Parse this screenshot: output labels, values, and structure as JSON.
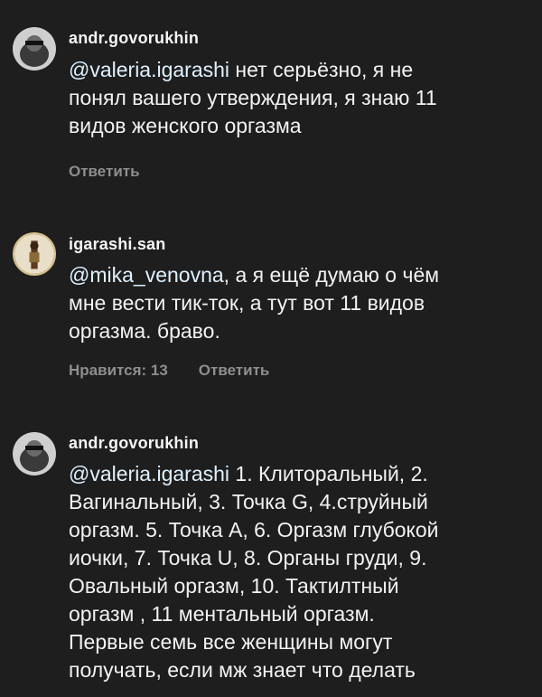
{
  "comments": [
    {
      "username": "andr.govorukhin",
      "mention": "@valeria.igarashi",
      "text_line1": " нет серьёзно,  я не",
      "text_line2": "понял вашего утверждения, я знаю 11",
      "text_line3": "видов женского оргазма",
      "reply": "Ответить"
    },
    {
      "username": "igarashi.san",
      "mention": "@mika_venovna",
      "text_line1": ", а я ещё думаю о чём",
      "text_line2": "мне вести тик-ток, а тут вот 11 видов",
      "text_line3": "оргазма. браво.",
      "likes": "Нравится: 13",
      "reply": "Ответить"
    },
    {
      "username": "andr.govorukhin",
      "mention": "@valeria.igarashi",
      "text_line1": " 1. Клиторальный, 2.",
      "text_line2": "Вагинальный, 3. Точка G, 4.струйный",
      "text_line3": "оргазм. 5. Точка А, 6. Оргазм глубокой",
      "text_line4": "иочки, 7. Точка U, 8. Органы груди, 9.",
      "text_line5": "Овальный оргазм, 10. Тактилтный",
      "text_line6": "оргазм , 11 ментальный оргазм.",
      "text_line7": "Первые семь все женщины могут",
      "text_line8": "получать, если мж знает что делать"
    }
  ],
  "colors": {
    "background": "#1e1e1e",
    "text": "#f2f2f2",
    "mention": "#e0f1ff",
    "muted": "#8e8e8e"
  }
}
